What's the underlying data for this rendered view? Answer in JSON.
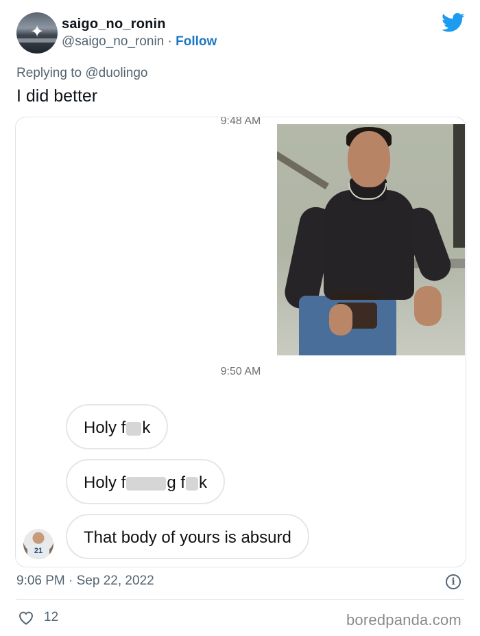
{
  "author": {
    "display_name": "saigo_no_ronin",
    "handle": "@saigo_no_ronin",
    "separator": " · ",
    "follow_label": "Follow"
  },
  "reply": {
    "prefix": "Replying to ",
    "mention": "@duolingo"
  },
  "tweet_text": "I did better",
  "chat": {
    "time_1": "9:48 AM",
    "time_2": "9:50 AM",
    "messages": [
      {
        "pre": "Holy f",
        "post": "k"
      },
      {
        "pre": "Holy f",
        "mid": "g f",
        "post": "k"
      },
      {
        "text": "That body of yours is absurd"
      }
    ],
    "avatar_jersey_number": "21"
  },
  "footer": {
    "time": "9:06 PM",
    "separator": " · ",
    "date": "Sep 22, 2022",
    "likes": "12"
  },
  "watermark": "boredpanda.com",
  "colors": {
    "accent": "#1d9bf0",
    "follow": "#1d77c2",
    "muted": "#536471"
  },
  "icons": {
    "brand": "twitter-bird-icon",
    "info": "info-icon",
    "like": "heart-icon"
  }
}
